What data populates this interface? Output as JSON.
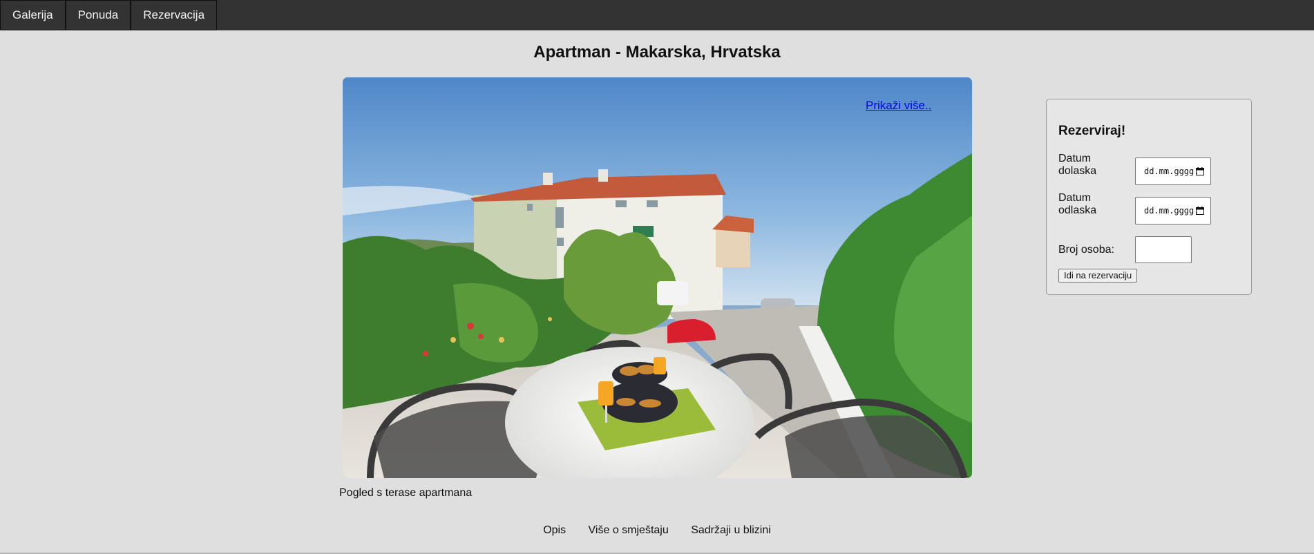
{
  "nav": {
    "items": [
      {
        "label": "Galerija"
      },
      {
        "label": "Ponuda"
      },
      {
        "label": "Rezervacija"
      }
    ]
  },
  "page": {
    "title": "Apartman - Makarska, Hrvatska"
  },
  "hero": {
    "show_more": "Prikaži više..",
    "caption": "Pogled s terase apartmana"
  },
  "booking": {
    "title": "Rezerviraj!",
    "arrival_label": "Datum dolaska",
    "departure_label": "Datum odlaska",
    "date_placeholder": "dd.mm.gggg.",
    "persons_label": "Broj osoba:",
    "persons_value": "",
    "submit_label": "Idi na rezervaciju"
  },
  "footer": {
    "links": [
      {
        "label": "Opis"
      },
      {
        "label": "Više o smještaju"
      },
      {
        "label": "Sadržaji u blizini"
      }
    ]
  },
  "icons": {
    "date_picker": "calendar-icon"
  }
}
